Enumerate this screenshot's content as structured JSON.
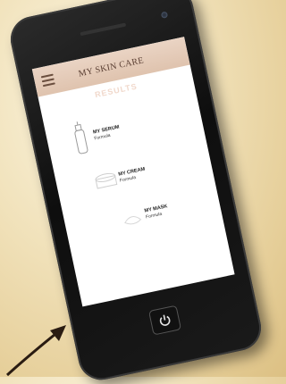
{
  "app": {
    "title": "MY SKIN CARE",
    "section": "RESULTS"
  },
  "results": [
    {
      "name": "MY SERUM",
      "sub": "Formula",
      "icon": "serum-bottle-icon"
    },
    {
      "name": "MY CREAM",
      "sub": "Formula",
      "icon": "cream-jar-icon"
    },
    {
      "name": "MY MASK",
      "sub": "Formula",
      "icon": "mask-icon"
    }
  ],
  "icons": {
    "menu": "hamburger-menu-icon",
    "home": "power-icon"
  }
}
